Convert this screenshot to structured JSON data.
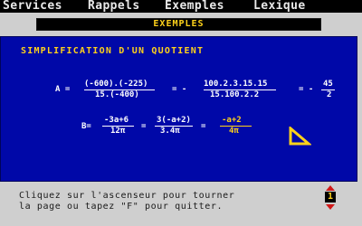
{
  "menu": {
    "items": [
      "Services",
      "Rappels",
      "Exemples",
      "Lexique"
    ]
  },
  "section_title": "EXEMPLES",
  "panel": {
    "title": "SIMPLIFICATION D'UN QUOTIENT",
    "A": {
      "label": "A =",
      "frac1_num": "(-600).(-225)",
      "frac1_den": "15.(-400)",
      "eq1": "= -",
      "frac2_num": "100.2.3.15.15",
      "frac2_den": "15.100.2.2",
      "eq2": "= -",
      "frac3_num": "45",
      "frac3_den": "2"
    },
    "B": {
      "label": "B=",
      "frac1_num": "-3a+6",
      "frac1_den": "12π",
      "eq1": "=",
      "frac2_num": "3(-a+2)",
      "frac2_den": "3.4π",
      "eq2": "=",
      "frac3_num": "-a+2",
      "frac3_den": "4π"
    }
  },
  "instructions": {
    "line1": "Cliquez sur l'ascenseur pour tourner",
    "line2": "la page ou tapez \"F\" pour quitter."
  },
  "page_indicator": {
    "page": "1"
  },
  "colors": {
    "panel": "#0008a8",
    "accent": "#ffd21a",
    "background": "#cfcfcf",
    "scroll_arrows": "#d01818"
  }
}
